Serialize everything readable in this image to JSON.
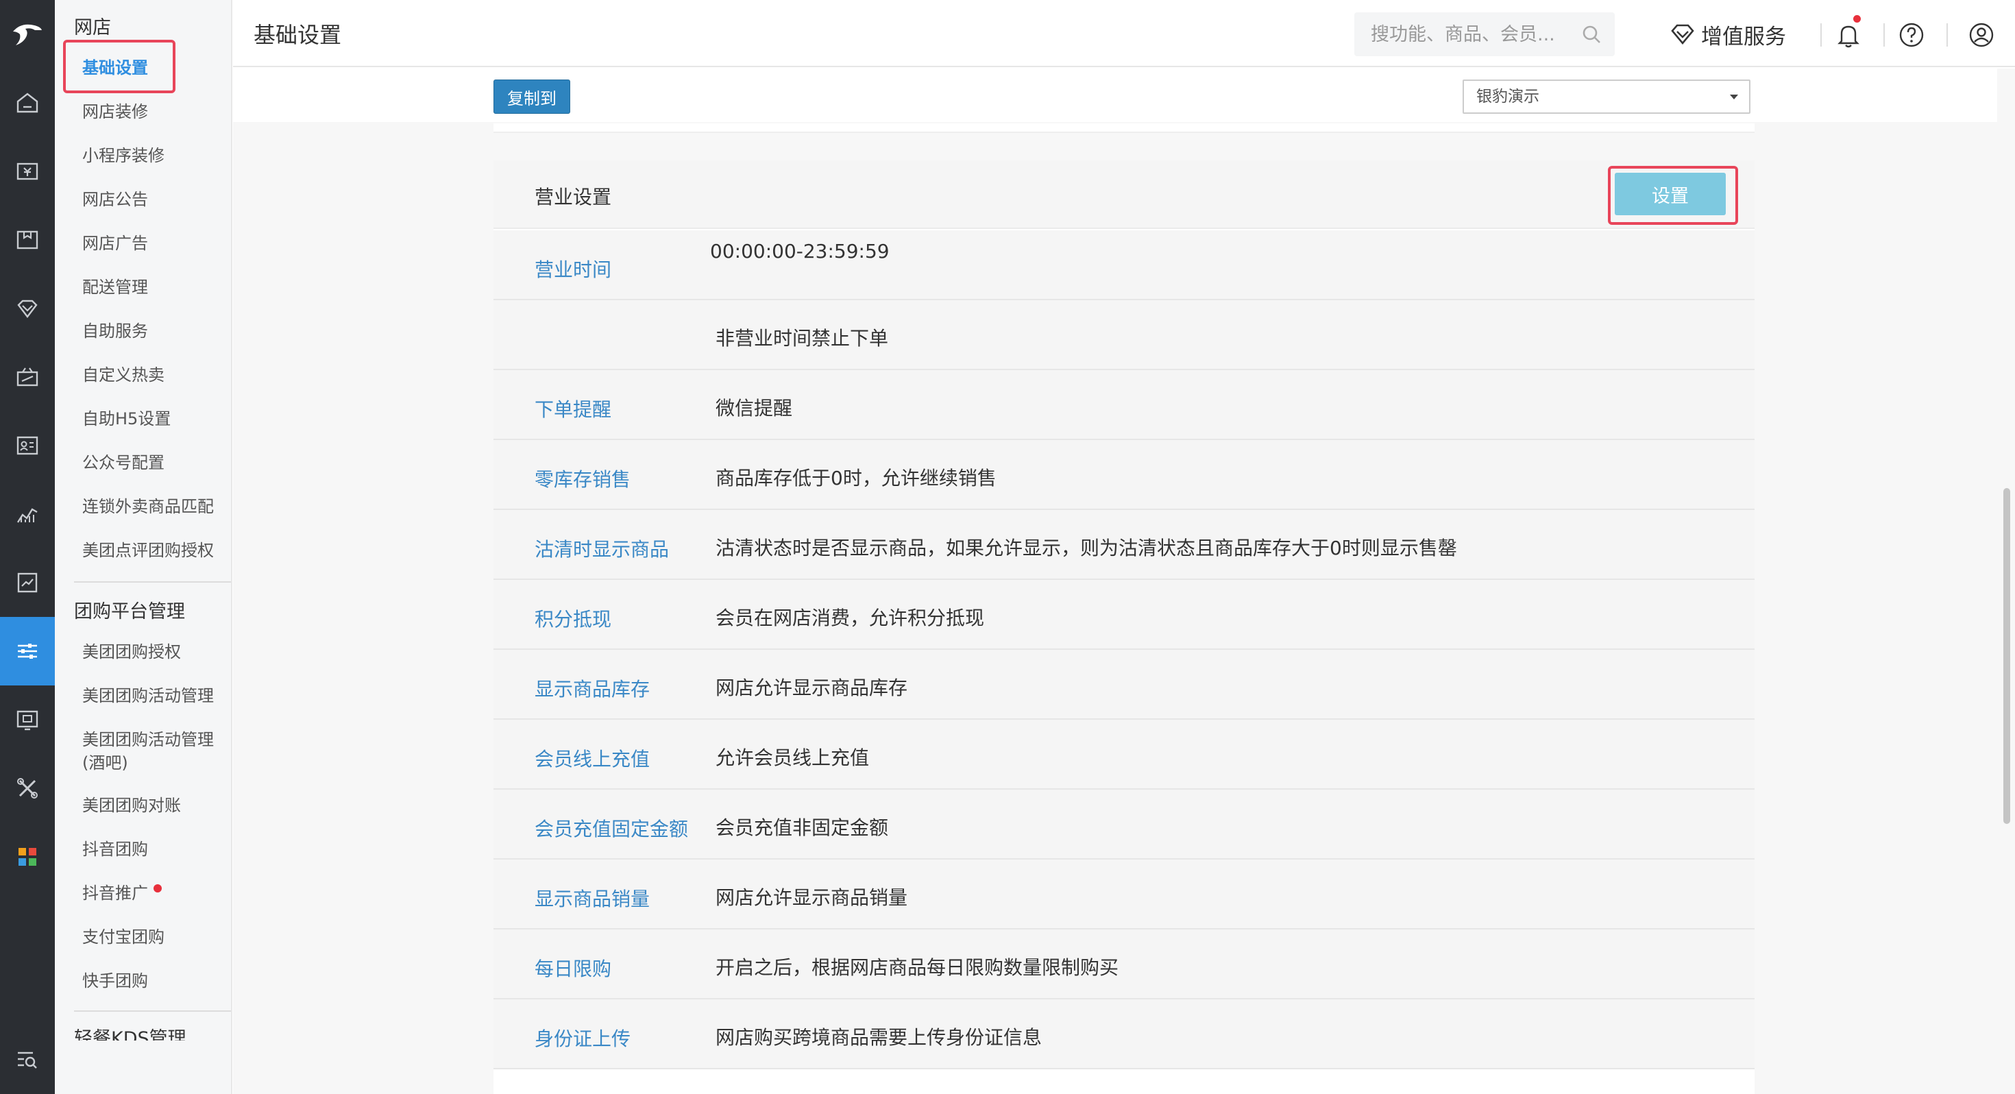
{
  "menu": {
    "group_webstore": "网店",
    "group_groupbuy": "团购平台管理",
    "group_kds_partial": "轻餐KDS管理",
    "webstore_items": [
      {
        "label": "基础设置"
      },
      {
        "label": "网店装修"
      },
      {
        "label": "小程序装修"
      },
      {
        "label": "网店公告"
      },
      {
        "label": "网店广告"
      },
      {
        "label": "配送管理"
      },
      {
        "label": "自助服务"
      },
      {
        "label": "自定义热卖"
      },
      {
        "label": "自助H5设置"
      },
      {
        "label": "公众号配置"
      },
      {
        "label": "连锁外卖商品匹配"
      },
      {
        "label": "美团点评团购授权"
      }
    ],
    "groupbuy_items": [
      {
        "label": "美团团购授权"
      },
      {
        "label": "美团团购活动管理"
      },
      {
        "label": "美团团购活动管理(酒吧)"
      },
      {
        "label": "美团团购对账"
      },
      {
        "label": "抖音团购"
      },
      {
        "label": "抖音推广"
      },
      {
        "label": "支付宝团购"
      },
      {
        "label": "快手团购"
      }
    ]
  },
  "header": {
    "title": "基础设置",
    "search_placeholder": "搜功能、商品、会员...",
    "value_added": "增值服务"
  },
  "toolbar": {
    "copy_to": "复制到",
    "store_selected": "银豹演示"
  },
  "business": {
    "section_title": "营业设置",
    "set_button": "设置",
    "rows": [
      {
        "key": "营业时间",
        "value": "00:00:00-23:59:59"
      },
      {
        "key": "",
        "value": "非营业时间禁止下单"
      },
      {
        "key": "下单提醒",
        "value": "微信提醒"
      },
      {
        "key": "零库存销售",
        "value": "商品库存低于0时，允许继续销售"
      },
      {
        "key": "沽清时显示商品",
        "value": "沽清状态时是否显示商品，如果允许显示，则为沽清状态且商品库存大于0时则显示售罄"
      },
      {
        "key": "积分抵现",
        "value": "会员在网店消费，允许积分抵现"
      },
      {
        "key": "显示商品库存",
        "value": "网店允许显示商品库存"
      },
      {
        "key": "会员线上充值",
        "value": "允许会员线上充值"
      },
      {
        "key": "会员充值固定金额",
        "value": "会员充值非固定金额"
      },
      {
        "key": "显示商品销量",
        "value": "网店允许显示商品销量"
      },
      {
        "key": "每日限购",
        "value": "开启之后，根据网店商品每日限购数量限制购买"
      },
      {
        "key": "身份证上传",
        "value": "网店购买跨境商品需要上传身份证信息"
      }
    ]
  },
  "icons": {
    "rail": [
      "logo-icon",
      "home-icon",
      "cashier-icon",
      "product-icon",
      "member-icon",
      "promotion-icon",
      "staff-icon",
      "report-icon",
      "finance-icon",
      "settings-icon",
      "ad-icon",
      "tools-icon",
      "apps-icon",
      "search-menu-icon"
    ],
    "header": [
      "search-icon",
      "diamond-icon",
      "bell-icon",
      "help-icon",
      "user-icon"
    ]
  },
  "colors": {
    "accent": "#2f8ee0",
    "highlight": "#e8455a",
    "link": "#3a88c6",
    "set_button": "#7ec9e0",
    "copy_button": "#2e84bf"
  }
}
